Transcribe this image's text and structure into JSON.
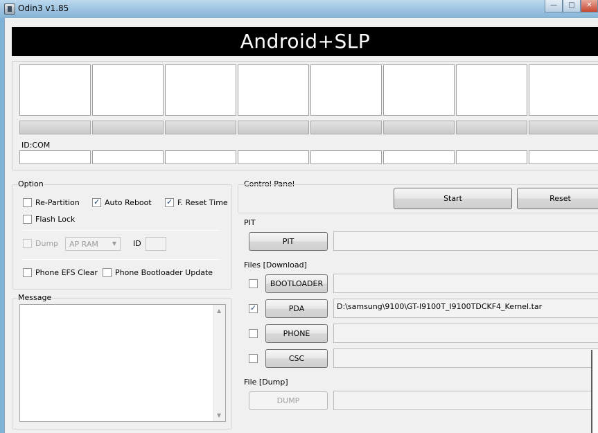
{
  "window": {
    "title": "Odin3 v1.85",
    "minimize_glyph": "—",
    "maximize_glyph": "□",
    "close_glyph": "✕"
  },
  "banner": {
    "text": "Android+SLP"
  },
  "ports": {
    "id_com_label": "ID:COM"
  },
  "option": {
    "label": "Option",
    "re_partition": {
      "label": "Re-Partition",
      "checked": false
    },
    "auto_reboot": {
      "label": "Auto Reboot",
      "checked": true
    },
    "f_reset_time": {
      "label": "F. Reset Time",
      "checked": true
    },
    "flash_lock": {
      "label": "Flash Lock",
      "checked": false
    },
    "dump": {
      "label": "Dump",
      "checked": false
    },
    "dump_select": "AP RAM",
    "id_label": "ID",
    "phone_efs_clear": {
      "label": "Phone EFS Clear",
      "checked": false
    },
    "phone_bootloader_update": {
      "label": "Phone Bootloader Update",
      "checked": false
    }
  },
  "message": {
    "label": "Message",
    "text": ""
  },
  "control_panel": {
    "label": "Control Panel",
    "start_label": "Start",
    "reset_label": "Reset"
  },
  "pit": {
    "label": "PIT",
    "button_label": "PIT",
    "path": ""
  },
  "files_download": {
    "label": "Files [Download]",
    "bootloader": {
      "button_label": "BOOTLOADER",
      "checked": false,
      "path": ""
    },
    "pda": {
      "button_label": "PDA",
      "checked": true,
      "path": "D:\\samsung\\9100\\GT-I9100T_I9100TDCKF4_Kernel.tar"
    },
    "phone": {
      "button_label": "PHONE",
      "checked": false,
      "path": ""
    },
    "csc": {
      "button_label": "CSC",
      "checked": false,
      "path": ""
    }
  },
  "file_dump": {
    "label": "File [Dump]",
    "button_label": "DUMP",
    "path": ""
  },
  "icons": {
    "app": "odin-app-icon",
    "scroll_up": "scroll-up-arrow-icon",
    "scroll_down": "scroll-down-arrow-icon",
    "dropdown": "chevron-down-icon"
  }
}
